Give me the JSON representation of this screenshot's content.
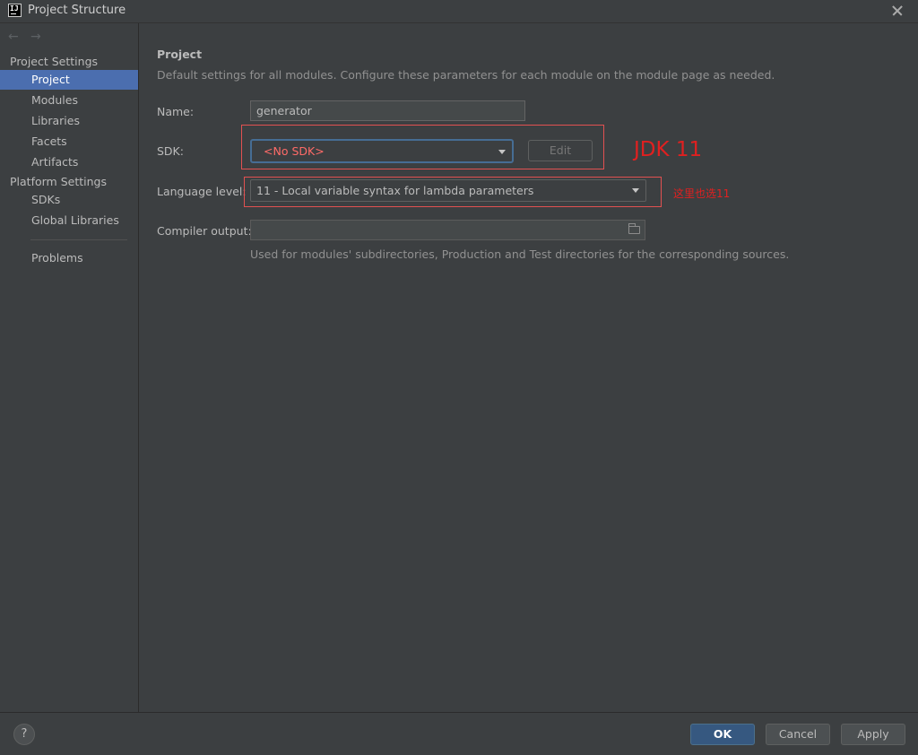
{
  "window": {
    "title": "Project Structure",
    "app_icon_text": "IJ"
  },
  "sidebar": {
    "project_settings_title": "Project Settings",
    "project_settings_items": [
      {
        "label": "Project",
        "selected": true
      },
      {
        "label": "Modules"
      },
      {
        "label": "Libraries"
      },
      {
        "label": "Facets"
      },
      {
        "label": "Artifacts"
      }
    ],
    "platform_settings_title": "Platform Settings",
    "platform_settings_items": [
      {
        "label": "SDKs"
      },
      {
        "label": "Global Libraries"
      }
    ],
    "problems_label": "Problems"
  },
  "main": {
    "title": "Project",
    "description": "Default settings for all modules. Configure these parameters for each module on the module page as needed.",
    "name_label": "Name:",
    "name_value": "generator",
    "sdk_label": "SDK:",
    "sdk_value": "<No SDK>",
    "edit_label": "Edit",
    "sdk_annotation": "JDK 11",
    "language_level_label": "Language level:",
    "language_level_value": "11 - Local variable syntax for lambda parameters",
    "language_level_annotation": "这里也选11",
    "compiler_output_label": "Compiler output:",
    "compiler_output_value": "",
    "compiler_output_hint": "Used for modules' subdirectories, Production and Test directories for the corresponding sources."
  },
  "footer": {
    "help_label": "?",
    "ok_label": "OK",
    "cancel_label": "Cancel",
    "apply_label": "Apply"
  },
  "colors": {
    "selection": "#4b6eaf",
    "annotation_red": "#e02020",
    "error_text": "#ff6b68",
    "ok_button": "#365880"
  }
}
